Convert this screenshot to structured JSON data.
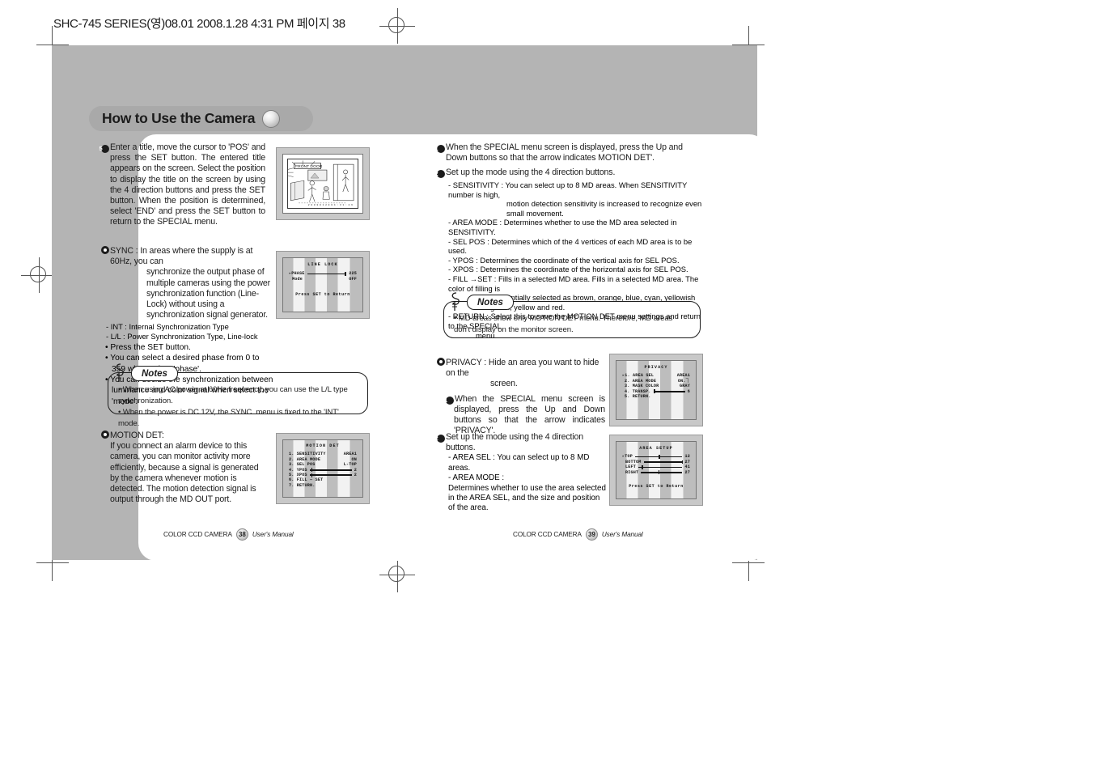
{
  "print_header": "SHC-745 SERIES(영)08.01  2008.1.28 4:31 PM 페이지 38",
  "title": {
    "text": "How to Use the Camera"
  },
  "left_column": {
    "step5": {
      "marker": "5",
      "text": "Enter a title, move the cursor to 'POS' and press the SET button. The entered title appears on the screen. Select the position to display the title on the screen by using the 4 direction buttons and press the SET button. When the position is determined, select 'END' and press the SET button to return to the SPECIAL menu."
    },
    "sync": {
      "heading": "SYNC : In areas where the supply is at 60Hz, you can",
      "cont": "synchronize the output phase of multiple cameras using the power synchronization function (Line-Lock) without using a synchronization signal generator.",
      "dash_items": [
        "- INT : Internal Synchronization Type",
        "- L/L : Power Synchronization Type, Line-lock"
      ],
      "dot_items": [
        "Press the SET button.",
        "You can select a desired phase from 0 to 359 when select 'phase'.",
        "You can decide the synchronization between luminance and color signal when select the 'mode'."
      ]
    },
    "notes": {
      "label": "Notes",
      "lines": [
        "When using AC power at 60Hz frequency, you can use the L/L type synchronization.",
        "When the power is DC 12V, the SYNC. menu is fixed to the 'INT' mode."
      ]
    },
    "motion_det": {
      "heading": "MOTION DET:",
      "text": "If you connect an alarm device to this camera, you can monitor activity more efficiently, because a signal is generated by the camera whenever motion is detected. The motion detection signal is output through the MD OUT port."
    }
  },
  "right_column": {
    "step1": {
      "marker": "1",
      "text": "When the SPECIAL menu screen is displayed, press the Up and Down buttons so that the arrow indicates  MOTION DET'."
    },
    "step2": {
      "marker": "2",
      "text": "Set up the mode using the 4 direction buttons."
    },
    "md_items": [
      {
        "label": "- SENSITIVITY : You can select up to 8 MD areas. When SENSITIVITY number is high,",
        "cont": "motion detection sensitivity is increased to recognize even small movement."
      },
      {
        "label": "- AREA MODE : Determines whether to use the MD area selected in SENSITIVITY.",
        "cont": ""
      },
      {
        "label": "- SEL POS : Determines which of the 4 vertices of each MD area is to be used.",
        "cont": ""
      },
      {
        "label": "- YPOS : Determines the coordinate of the vertical axis for SEL POS.",
        "cont": ""
      },
      {
        "label": "- XPOS : Determines the coordinate of the horizontal axis for SEL POS.",
        "cont": ""
      },
      {
        "label": "- FILL  →SET : Fills in a selected MD area. Fills in a selected MD area. The color of filling is",
        "cont": "sequentially selected as brown, orange, blue, cyan, yellowish green, yellow and red."
      },
      {
        "label": "- RETURN : Select this to save the MOTION DET menu settings and return to the SPECIAL",
        "cont": "menu."
      }
    ],
    "notes": {
      "label": "Notes",
      "lines": [
        "MD areas show only MOTION DET menu. Therefore, MD areas don't display on the monitor screen."
      ]
    },
    "privacy": {
      "heading": "PRIVACY : Hide an area you want to hide on the",
      "heading_cont": "screen.",
      "step1_marker": "1",
      "step1": "When the SPECIAL menu screen is displayed, press the Up and Down buttons so that the arrow indicates 'PRIVACY'.",
      "step2_marker": "2",
      "step2": "Set up the mode using the 4 direction buttons.",
      "items": [
        "- AREA SEL : You can select up to 8 MD areas.",
        "- AREA MODE :"
      ],
      "item_body": "Determines whether to use the area selected in the AREA SEL, and the size and position of the area."
    }
  },
  "osd": {
    "title_screen": {
      "name": "title-position-screen",
      "caption": "FRONT DOOR",
      "footer": "2 0 0 8 0 1 2 8  0 4 : 3 1 : 2 6"
    },
    "line_lock": {
      "title": "LINE LOCK",
      "rows": [
        {
          "cursor": true,
          "label": "PHASE",
          "bar": true,
          "knob_pct": 96,
          "value": "225"
        },
        {
          "cursor": false,
          "label": "Mode",
          "bar": false,
          "value": "OFF"
        }
      ],
      "footer": "Press SET to Return"
    },
    "motion_det": {
      "title": "MOTION DET",
      "rows": [
        {
          "label": "1. SENSITIVITY",
          "value": "AREA1",
          "bar": false
        },
        {
          "label": "2. AREA MODE",
          "value": "ON",
          "bar": false
        },
        {
          "label": "3. SEL POS",
          "value": "L-TOP",
          "bar": false
        },
        {
          "label": "4. YPOS",
          "value": "2",
          "bar": true,
          "knob_pct": 4
        },
        {
          "label": "5. XPOS",
          "value": "2",
          "bar": true,
          "knob_pct": 4
        },
        {
          "label": "6. FILL — SET",
          "value": "",
          "bar": false
        },
        {
          "label": "7. RETURN.",
          "value": "",
          "bar": false
        }
      ]
    },
    "privacy": {
      "title": "PRIVACY",
      "rows": [
        {
          "cursor": true,
          "label": "1. AREA SEL",
          "value": "AREA1",
          "bar": false
        },
        {
          "cursor": false,
          "label": "2. AREA MODE",
          "value": "ON.⏋",
          "bar": false
        },
        {
          "cursor": false,
          "label": "3. MASK COLOR",
          "value": "GRAY",
          "bar": false
        },
        {
          "cursor": false,
          "label": "4. TRANSP.",
          "value": "6",
          "bar": true,
          "knob_pct": 2
        },
        {
          "cursor": false,
          "label": "5. RETURN.",
          "value": "",
          "bar": false
        }
      ]
    },
    "area_setup": {
      "title": "AREA SETUP",
      "rows": [
        {
          "cursor": true,
          "label": "TOP",
          "value": "12",
          "bar": true,
          "knob_pct": 50
        },
        {
          "cursor": false,
          "label": "BOTTOM",
          "value": "27",
          "bar": true,
          "knob_pct": 100
        },
        {
          "cursor": false,
          "label": "LEFT",
          "value": "41",
          "bar": true,
          "knob_pct": 8
        },
        {
          "cursor": false,
          "label": "RIGHT",
          "value": "27",
          "bar": true,
          "knob_pct": 42
        }
      ],
      "footer": "Press SET to Return"
    }
  },
  "footers": {
    "left": {
      "brand": "COLOR CCD CAMERA",
      "page": "38",
      "manual": "User's Manual"
    },
    "right": {
      "brand": "COLOR CCD CAMERA",
      "page": "39",
      "manual": "User's Manual"
    }
  }
}
